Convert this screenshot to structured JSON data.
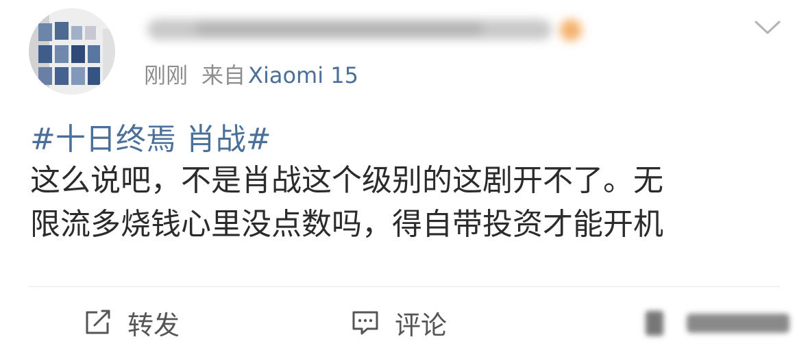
{
  "post": {
    "time": "刚刚",
    "source_label": "来自",
    "device": "Xiaomi 15",
    "hashtag": "#十日终焉 肖战#",
    "body_lines": [
      "这么说吧，不是肖战这个级别的这剧开不了。无",
      "限流多烧钱心里没点数吗，得自带投资才能开机"
    ]
  },
  "actions": {
    "repost_label": "转发",
    "comment_label": "评论"
  },
  "colors": {
    "link": "#4a6f99",
    "meta_gray": "#8d8d8d",
    "text": "#2b2b2b"
  },
  "icons": {
    "menu": "chevron-down-icon",
    "repost": "share-edit-icon",
    "comment": "comment-icon",
    "like": "thumbs-up-icon"
  }
}
